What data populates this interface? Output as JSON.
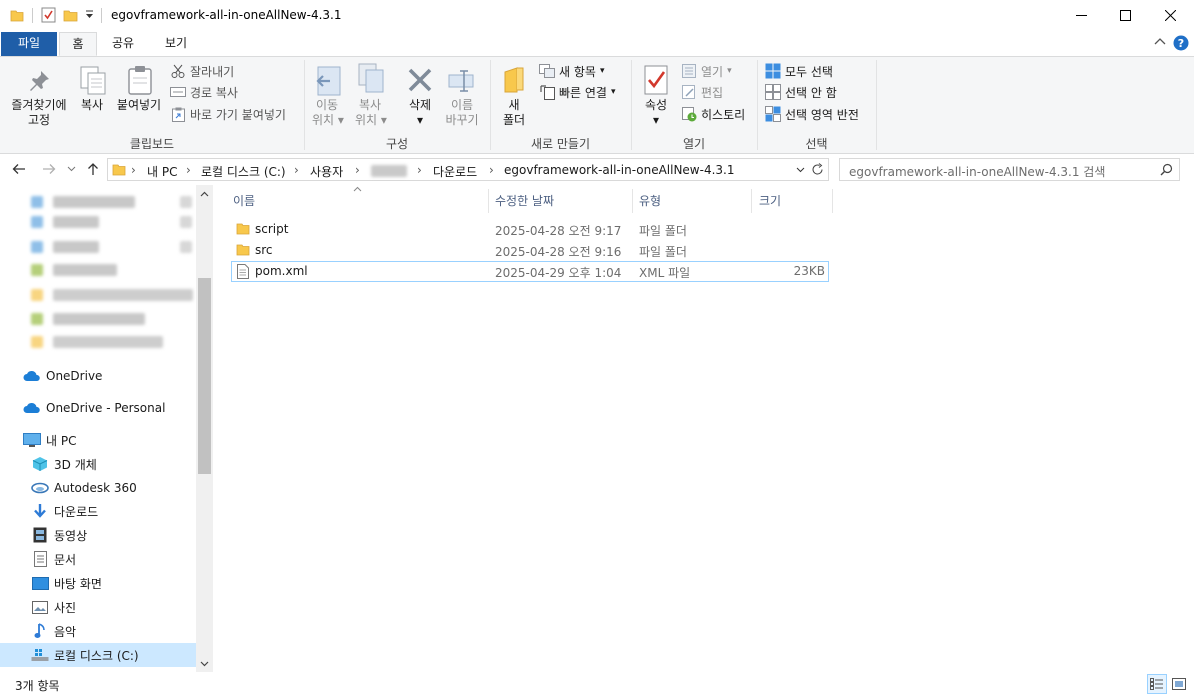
{
  "window": {
    "title": "egovframework-all-in-oneAllNew-4.3.1",
    "controls": {
      "minimize": "minimize-icon",
      "maximize": "maximize-icon",
      "close": "close-icon"
    }
  },
  "tabs": [
    "파일",
    "홈",
    "공유",
    "보기"
  ],
  "ribbon": {
    "clipboard": {
      "pin_label_1": "즐겨찾기에",
      "pin_label_2": "고정",
      "copy": "복사",
      "paste": "붙여넣기",
      "cut": "잘라내기",
      "copy_path": "경로 복사",
      "paste_shortcut": "바로 가기 붙여넣기",
      "group": "클립보드"
    },
    "organize": {
      "move_1": "이동",
      "move_2": "위치",
      "copy_1": "복사",
      "copy_2": "위치",
      "delete": "삭제",
      "rename_1": "이름",
      "rename_2": "바꾸기",
      "group": "구성"
    },
    "new": {
      "new_folder_1": "새",
      "new_folder_2": "폴더",
      "new_item": "새 항목",
      "easy_access": "빠른 연결",
      "group": "새로 만들기"
    },
    "open": {
      "properties": "속성",
      "open": "열기",
      "edit": "편집",
      "history": "히스토리",
      "group": "열기"
    },
    "select": {
      "select_all": "모두 선택",
      "select_none": "선택 안 함",
      "invert": "선택 영역 반전",
      "group": "선택"
    }
  },
  "address": {
    "crumbs": [
      "내 PC",
      "로컬 디스크 (C:)",
      "사용자",
      "다운로드",
      "egovframework-all-in-oneAllNew-4.3.1"
    ],
    "search_placeholder": "egovframework-all-in-oneAllNew-4.3.1 검색"
  },
  "nav": {
    "onedrive": "OneDrive",
    "onedrive_personal": "OneDrive - Personal",
    "this_pc": "내 PC",
    "items": [
      "3D 개체",
      "Autodesk 360",
      "다운로드",
      "동영상",
      "문서",
      "바탕 화면",
      "사진",
      "음악",
      "로컬 디스크 (C:)"
    ]
  },
  "columns": {
    "name": "이름",
    "modified": "수정한 날짜",
    "type": "유형",
    "size": "크기"
  },
  "files": [
    {
      "name": "script",
      "modified": "2025-04-28 오전 9:17",
      "type": "파일 폴더",
      "size": ""
    },
    {
      "name": "src",
      "modified": "2025-04-28 오전 9:16",
      "type": "파일 폴더",
      "size": ""
    },
    {
      "name": "pom.xml",
      "modified": "2025-04-29 오후 1:04",
      "type": "XML 파일",
      "size": "23KB"
    }
  ],
  "status": {
    "count": "3개 항목"
  },
  "colors": {
    "file_tab": "#1f5ea8",
    "selection": "#cce8ff",
    "folder": "#f8c84c",
    "header_text": "#4d6082"
  }
}
